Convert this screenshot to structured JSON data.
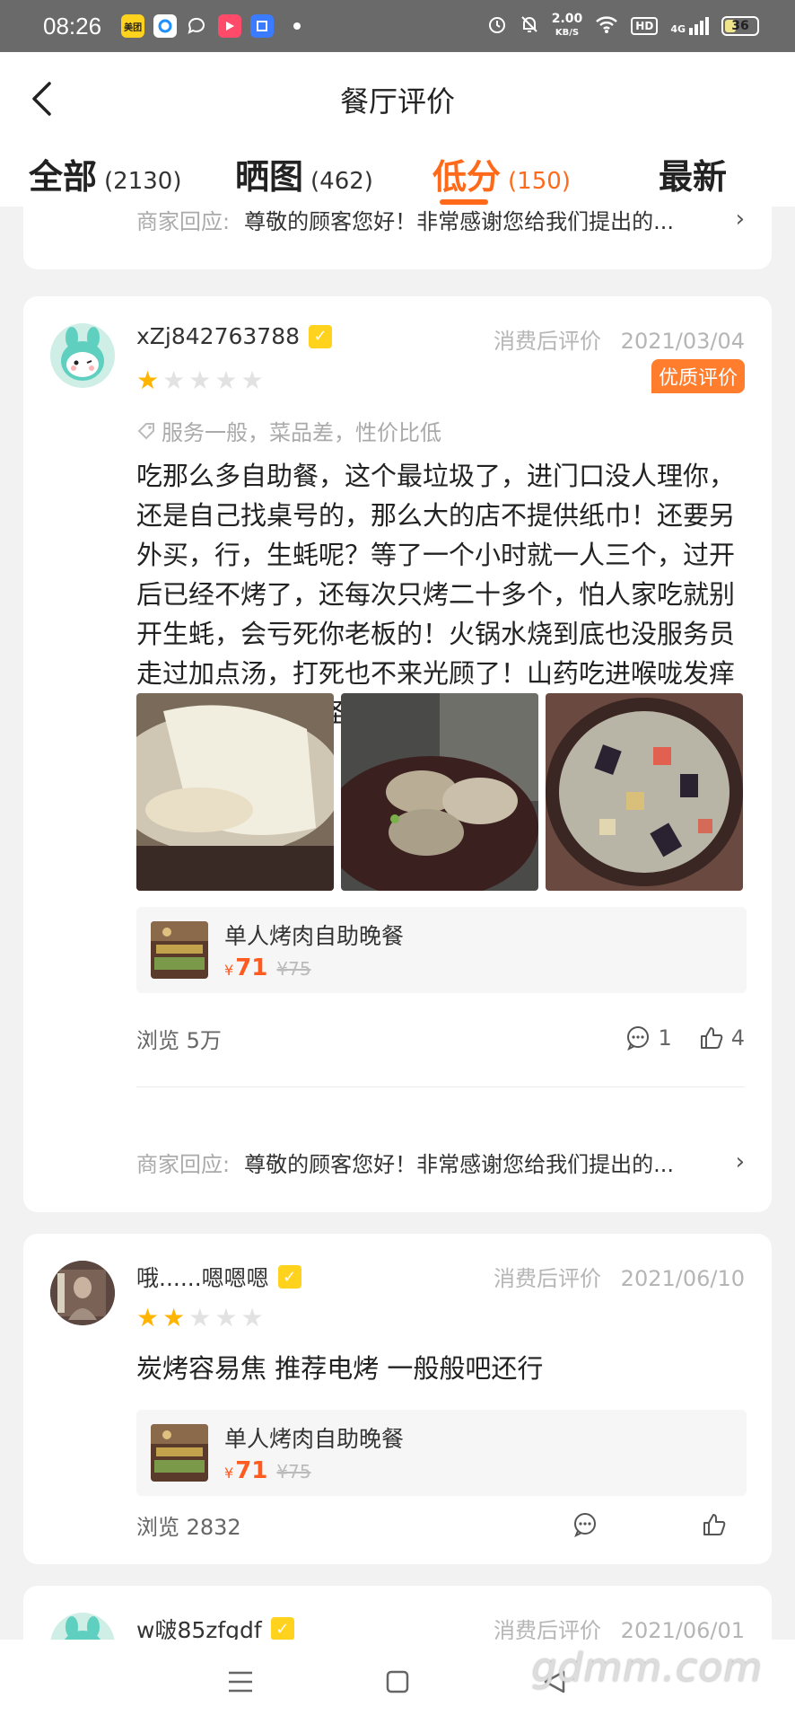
{
  "status_bar": {
    "time": "08:26",
    "app_icons": [
      {
        "name": "meituan-icon",
        "label": "美团",
        "color": "#ffd21e"
      },
      {
        "name": "browser-icon",
        "label": "",
        "color": "#1e90ff"
      },
      {
        "name": "chat-icon",
        "label": "",
        "color": "#888888"
      },
      {
        "name": "video-icon",
        "label": "",
        "color": "#ff4a6a"
      },
      {
        "name": "files-icon",
        "label": "",
        "color": "#3a7bff"
      }
    ],
    "speed_value": "2.00",
    "speed_unit": "KB/S",
    "hd": "HD",
    "network": "4G",
    "battery": "36"
  },
  "header": {
    "title": "餐厅评价",
    "tabs": [
      {
        "label": "全部",
        "count": "(2130)",
        "active": false
      },
      {
        "label": "晒图",
        "count": "(462)",
        "active": false
      },
      {
        "label": "低分",
        "count": "(150)",
        "active": true
      },
      {
        "label": "最新",
        "count": "",
        "active": false
      }
    ]
  },
  "reviews": [
    {
      "reply_label": "商家回应:",
      "reply_text": "尊敬的顾客您好！非常感谢您给我们提出的..."
    },
    {
      "username": "xZj842763788",
      "date_label": "消费后评价",
      "date": "2021/03/04",
      "rating": 1,
      "badge": "优质评价",
      "tags": "服务一般，菜品差，性价比低",
      "text": "吃那么多自助餐，这个最垃圾了，进门口没人理你，还是自己找桌号的，那么大的店不提供纸巾！还要另外买，行，生蚝呢？等了一个小时就一人三个，过开后已经不烤了，还每次只烤二十多个，怕人家吃就别开生蚝，会亏死你老板的！火锅水烧到底也没服务员走过加点汤，打死也不来光顾了！山药吃进喉咙发痒的，糖水里有阵怪味，隔夜那种",
      "product": {
        "name": "单人烤肉自助晚餐",
        "currency": "¥",
        "price": "71",
        "orig_price": "¥75"
      },
      "views": "浏览 5万",
      "comments": "1",
      "likes": "4",
      "reply_label": "商家回应:",
      "reply_text": "尊敬的顾客您好！非常感谢您给我们提出的..."
    },
    {
      "username": "哦......嗯嗯嗯",
      "date_label": "消费后评价",
      "date": "2021/06/10",
      "rating": 2,
      "text": "炭烤容易焦 推荐电烤 一般般吧还行",
      "product": {
        "name": "单人烤肉自助晚餐",
        "currency": "¥",
        "price": "71",
        "orig_price": "¥75"
      },
      "views": "浏览 2832",
      "comments": "",
      "likes": ""
    },
    {
      "username": "w啵85zfgdf",
      "date_label": "消费后评价",
      "date": "2021/06/01"
    }
  ],
  "watermark": "gdmm.com",
  "colors": {
    "accent": "#ff6a1a",
    "star": "#ffb400",
    "badge": "#ff7d2c"
  }
}
